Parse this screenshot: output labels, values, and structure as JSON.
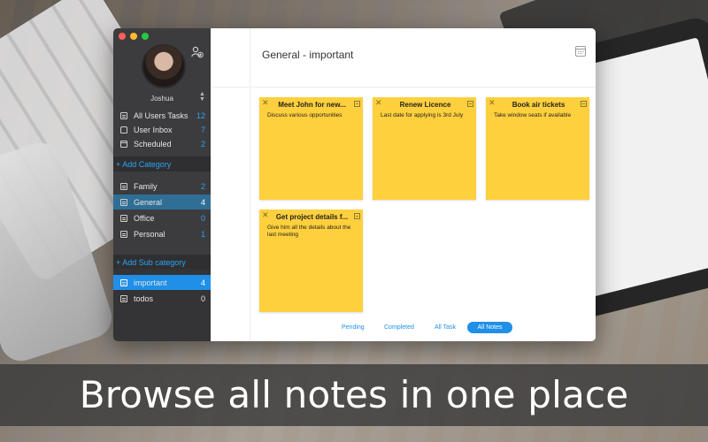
{
  "user": {
    "name": "Joshua"
  },
  "sidebar": {
    "top_items": [
      {
        "label": "All Users Tasks",
        "count": "12"
      },
      {
        "label": "User Inbox",
        "count": "7"
      },
      {
        "label": "Scheduled",
        "count": "2"
      }
    ],
    "add_category": "+ Add Category",
    "categories": [
      {
        "label": "Family",
        "count": "2"
      },
      {
        "label": "General",
        "count": "4"
      },
      {
        "label": "Office",
        "count": "0"
      },
      {
        "label": "Personal",
        "count": "1"
      }
    ],
    "add_sub_category": "+ Add Sub category",
    "sub_categories": [
      {
        "label": "important",
        "count": "4"
      },
      {
        "label": "todos",
        "count": "0"
      }
    ]
  },
  "main": {
    "title": "General - important",
    "notes": [
      {
        "title": "Meet John for new...",
        "body": "Discuss various opportunities"
      },
      {
        "title": "Renew Licence",
        "body": "Last date for applying is 3rd July"
      },
      {
        "title": "Book air tickets",
        "body": "Take window seats if available"
      },
      {
        "title": "Get project details f...",
        "body": "Give him all the details about the last meeting"
      }
    ],
    "filters": [
      {
        "label": "Pending"
      },
      {
        "label": "Completed"
      },
      {
        "label": "All Task"
      },
      {
        "label": "All Notes",
        "active": true
      }
    ]
  },
  "caption": "Browse all notes in one place",
  "colors": {
    "accent": "#1f8fe8",
    "note": "#ffd03d",
    "sidebar": "#3c3c3e"
  }
}
